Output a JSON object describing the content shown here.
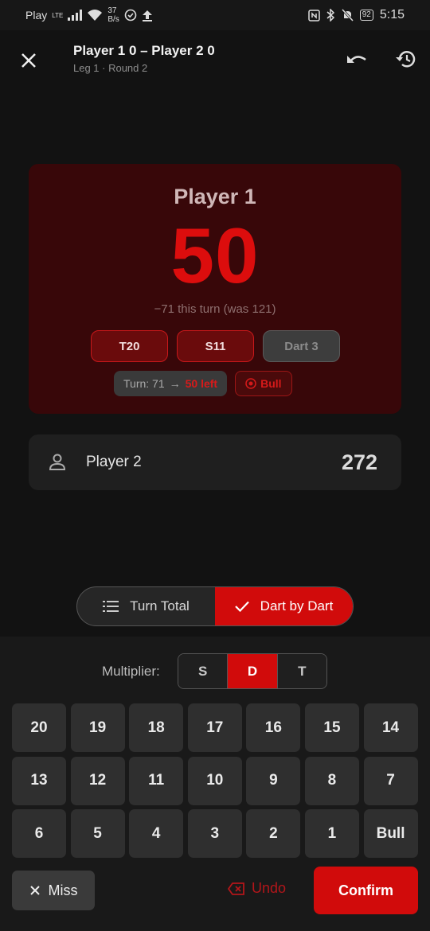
{
  "status_bar": {
    "carrier": "Play",
    "network": "LTE",
    "speed_value": "37",
    "speed_unit": "B/s",
    "battery": "92",
    "time": "5:15"
  },
  "header": {
    "title": "Player 1 0 – Player 2 0",
    "subtitle": "Leg 1 · Round 2"
  },
  "active_player": {
    "name": "Player 1",
    "score": "50",
    "turn_delta": "−71 this turn  (was 121)",
    "darts": [
      "T20",
      "S11",
      "Dart 3"
    ],
    "turn_label": "Turn: 71",
    "arrow": "→",
    "left_label": "50 left",
    "bull_label": "Bull"
  },
  "other_player": {
    "name": "Player 2",
    "score": "272"
  },
  "mode_toggle": {
    "turn_total": "Turn Total",
    "dart_by_dart": "Dart by Dart",
    "selected": "Dart by Dart"
  },
  "keypad": {
    "multiplier_label": "Multiplier:",
    "multipliers": [
      "S",
      "D",
      "T"
    ],
    "selected_multiplier": "D",
    "keys": [
      "20",
      "19",
      "18",
      "17",
      "16",
      "15",
      "14",
      "13",
      "12",
      "11",
      "10",
      "9",
      "8",
      "7",
      "6",
      "5",
      "4",
      "3",
      "2",
      "1",
      "Bull"
    ],
    "miss": "Miss",
    "undo": "Undo",
    "confirm": "Confirm"
  },
  "colors": {
    "accent": "#d10b0b",
    "active_card_bg": "#380709",
    "background": "#121212"
  }
}
